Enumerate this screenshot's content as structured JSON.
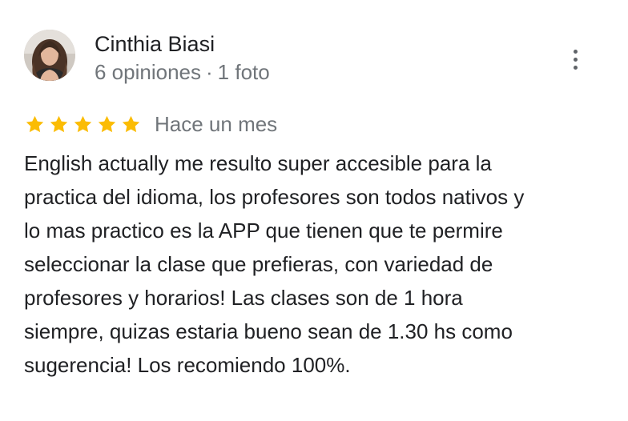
{
  "reviewer": {
    "name": "Cinthia Biasi",
    "reviews_count": "6 opiniones",
    "separator": "·",
    "photos_count": "1 foto"
  },
  "review": {
    "rating": 5,
    "rating_max": 5,
    "date": "Hace un mes",
    "text_lines": [
      "English actually me resulto super accesible para la",
      "practica del idioma, los profesores son todos nativos y",
      "lo mas practico es la APP que tienen que te permire",
      "seleccionar la clase que prefieras, con variedad de",
      "profesores y horarios! Las clases son de 1 hora",
      "siempre, quizas estaria bueno sean de 1.30 hs como",
      "sugerencia! Los recomiendo 100%."
    ]
  },
  "icons": {
    "avatar": "avatar-photo",
    "star": "star-icon",
    "more": "more-vert-icon"
  },
  "colors": {
    "star": "#fbbc04",
    "name": "#202124",
    "meta": "#70757a",
    "text": "#202124",
    "more_icon": "#5f6368"
  }
}
